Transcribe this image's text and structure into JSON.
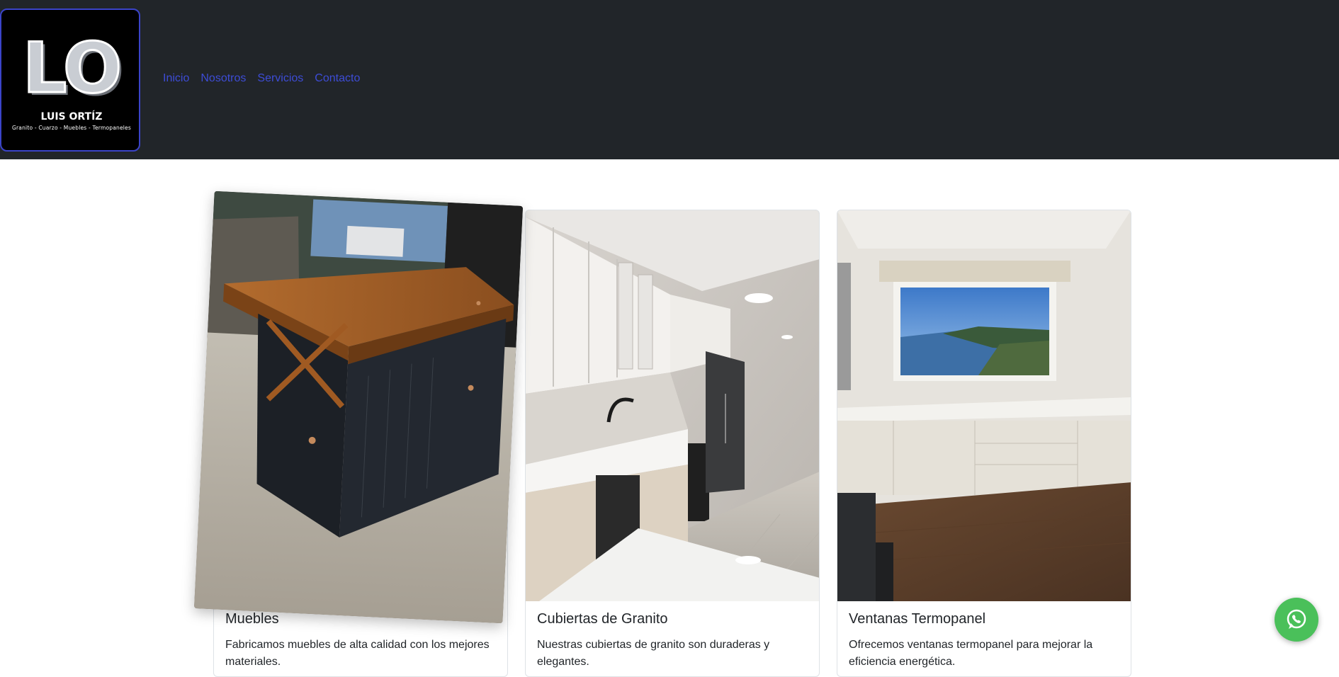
{
  "brand": {
    "letters": "LO",
    "name": "LUIS ORTÍZ",
    "tagline": "Granito - Cuarzo - Muebles - Termopaneles"
  },
  "nav": {
    "items": [
      {
        "label": "Inicio"
      },
      {
        "label": "Nosotros"
      },
      {
        "label": "Servicios"
      },
      {
        "label": "Contacto"
      }
    ]
  },
  "services": {
    "cards": [
      {
        "title": "Muebles",
        "text": "Fabricamos muebles de alta calidad con los mejores materiales.",
        "image_icon": "kitchen-island-photo"
      },
      {
        "title": "Cubiertas de Granito",
        "text": "Nuestras cubiertas de granito son duraderas y elegantes.",
        "image_icon": "kitchen-countertop-photo"
      },
      {
        "title": "Ventanas Termopanel",
        "text": "Ofrecemos ventanas termopanel para mejorar la eficiencia energética.",
        "image_icon": "window-view-photo"
      }
    ]
  },
  "floating": {
    "whatsapp_icon": "whatsapp-icon"
  },
  "colors": {
    "navbar_bg": "#212529",
    "nav_link": "#3d4cd6",
    "logo_border": "#3b44c9",
    "whatsapp": "#4ac05a"
  }
}
